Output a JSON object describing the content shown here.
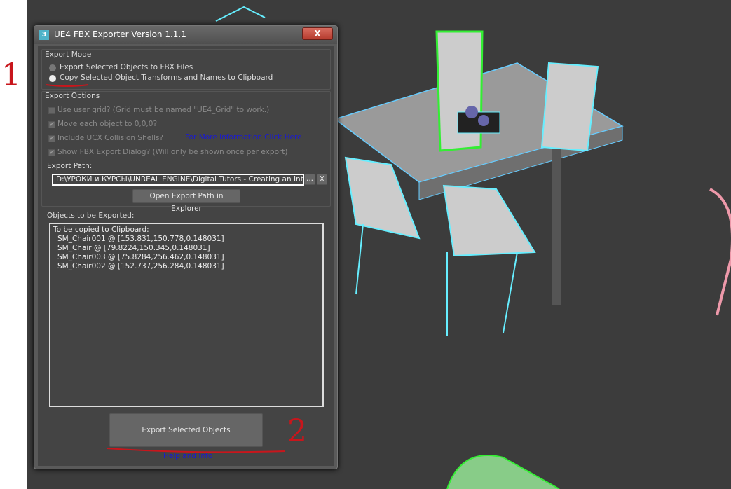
{
  "dialog": {
    "title": "UE4 FBX Exporter Version 1.1.1",
    "app_icon": "3",
    "close_label": "X"
  },
  "export_mode": {
    "label": "Export Mode",
    "options": [
      "Export Selected Objects to FBX Files",
      "Copy Selected Object Transforms and Names to Clipboard"
    ],
    "selected": 1
  },
  "export_options": {
    "label": "Export Options",
    "checkboxes": [
      {
        "label": "Use user grid? (Grid must be named \"UE4_Grid\" to work.)",
        "checked": false
      },
      {
        "label": "Move each object to 0,0,0?",
        "checked": true
      },
      {
        "label": "Include UCX Collision Shells?",
        "checked": true
      },
      {
        "label": "Show FBX Export Dialog? (Will only be shown once per export)",
        "checked": true
      }
    ],
    "more_info_link": "For More Information Click Here"
  },
  "export_path": {
    "label": "Export Path:",
    "value": "D:\\УРОКИ и КУРСЫ\\UNREAL ENGINE\\Digital Tutors - Creating an Interior",
    "browse_label": "...",
    "clear_label": "X",
    "open_label": "Open Export Path in Explorer"
  },
  "objects": {
    "label": "Objects to be Exported:",
    "header": "To be copied to Clipboard:",
    "items": [
      "SM_Chair001 @ [153.831,150.778,0.148031]",
      "SM_Chair @ [79.8224,150.345,0.148031]",
      "SM_Chair003 @ [75.8284,256.462,0.148031]",
      "SM_Chair002 @ [152.737,256.284,0.148031]"
    ]
  },
  "export_button": "Export Selected Objects",
  "help_link": "Help and Info",
  "annotations": [
    "1",
    "2"
  ],
  "colors": {
    "accent_link": "#1a1ad0",
    "annotation": "#c8161c"
  }
}
